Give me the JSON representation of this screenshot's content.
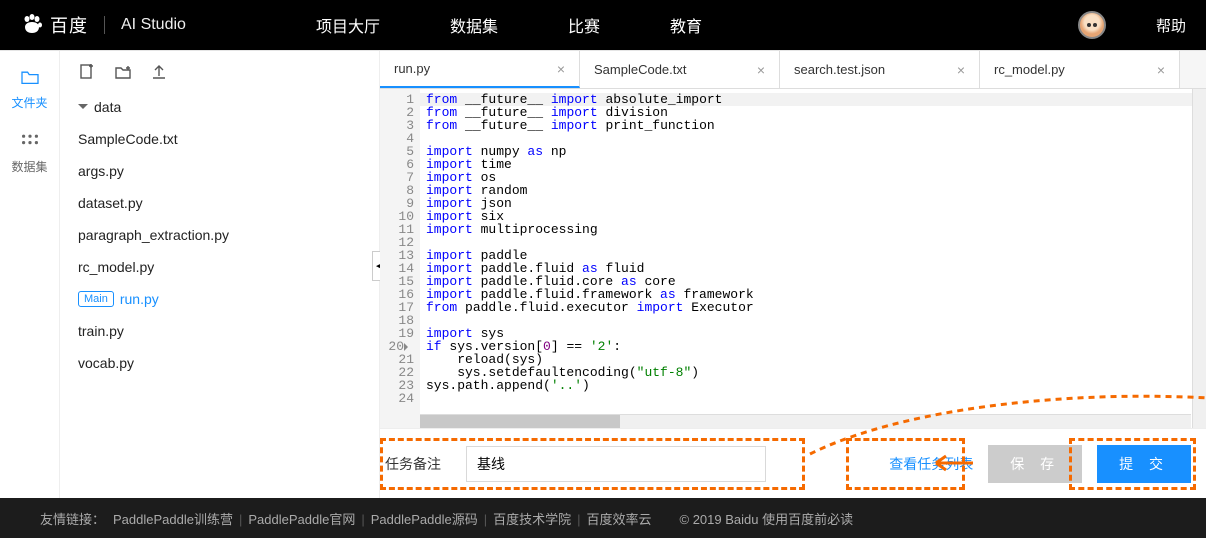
{
  "header": {
    "logo_text": "百度",
    "studio": "AI Studio",
    "nav": [
      "项目大厅",
      "数据集",
      "比赛",
      "教育"
    ],
    "help": "帮助"
  },
  "rail": {
    "files": "文件夹",
    "datasets": "数据集"
  },
  "toolbar_icons": {
    "new": "new-file-icon",
    "newfolder": "new-folder-icon",
    "upload": "upload-icon"
  },
  "explorer": {
    "folder": "data",
    "files": [
      "SampleCode.txt",
      "args.py",
      "dataset.py",
      "paragraph_extraction.py",
      "rc_model.py"
    ],
    "main_badge": "Main",
    "active_file": "run.py",
    "files_after": [
      "train.py",
      "vocab.py"
    ]
  },
  "tabs": [
    {
      "label": "run.py",
      "active": true
    },
    {
      "label": "SampleCode.txt",
      "active": false
    },
    {
      "label": "search.test.json",
      "active": false
    },
    {
      "label": "rc_model.py",
      "active": false
    }
  ],
  "code": {
    "lines": [
      {
        "n": 1,
        "html": "<span class='kw'>from</span> __future__ <span class='kw'>import</span> absolute_import",
        "hl": true
      },
      {
        "n": 2,
        "html": "<span class='kw'>from</span> __future__ <span class='kw'>import</span> division"
      },
      {
        "n": 3,
        "html": "<span class='kw'>from</span> __future__ <span class='kw'>import</span> print_function"
      },
      {
        "n": 4,
        "html": ""
      },
      {
        "n": 5,
        "html": "<span class='kw'>import</span> numpy <span class='kw'>as</span> np"
      },
      {
        "n": 6,
        "html": "<span class='kw'>import</span> time"
      },
      {
        "n": 7,
        "html": "<span class='kw'>import</span> os"
      },
      {
        "n": 8,
        "html": "<span class='kw'>import</span> random"
      },
      {
        "n": 9,
        "html": "<span class='kw'>import</span> json"
      },
      {
        "n": 10,
        "html": "<span class='kw'>import</span> six"
      },
      {
        "n": 11,
        "html": "<span class='kw'>import</span> multiprocessing"
      },
      {
        "n": 12,
        "html": ""
      },
      {
        "n": 13,
        "html": "<span class='kw'>import</span> paddle"
      },
      {
        "n": 14,
        "html": "<span class='kw'>import</span> paddle.fluid <span class='kw'>as</span> fluid"
      },
      {
        "n": 15,
        "html": "<span class='kw'>import</span> paddle.fluid.core <span class='kw'>as</span> core"
      },
      {
        "n": 16,
        "html": "<span class='kw'>import</span> paddle.fluid.framework <span class='kw'>as</span> framework"
      },
      {
        "n": 17,
        "html": "<span class='kw'>from</span> paddle.fluid.executor <span class='kw'>import</span> Executor"
      },
      {
        "n": 18,
        "html": ""
      },
      {
        "n": 19,
        "html": "<span class='kw'>import</span> sys"
      },
      {
        "n": 20,
        "html": "<span class='kw'>if</span> sys.version[<span class='num'>0</span>] == <span class='str'>'2'</span>:",
        "diamond": true
      },
      {
        "n": 21,
        "html": "    reload(sys)"
      },
      {
        "n": 22,
        "html": "    sys.setdefaultencoding(<span class='str'>\"utf-8\"</span>)"
      },
      {
        "n": 23,
        "html": "sys.path.append(<span class='str'>'..'</span>)"
      },
      {
        "n": 24,
        "html": ""
      }
    ]
  },
  "taskbar": {
    "label": "任务备注",
    "input_value": "基线",
    "view_list": "查看任务列表",
    "save": "保 存",
    "submit": "提 交"
  },
  "footer": {
    "prefix": "友情链接：",
    "links": [
      "PaddlePaddle训练营",
      "PaddlePaddle官网",
      "PaddlePaddle源码",
      "百度技术学院",
      "百度效率云"
    ],
    "copyright": "© 2019 Baidu 使用百度前必读"
  }
}
